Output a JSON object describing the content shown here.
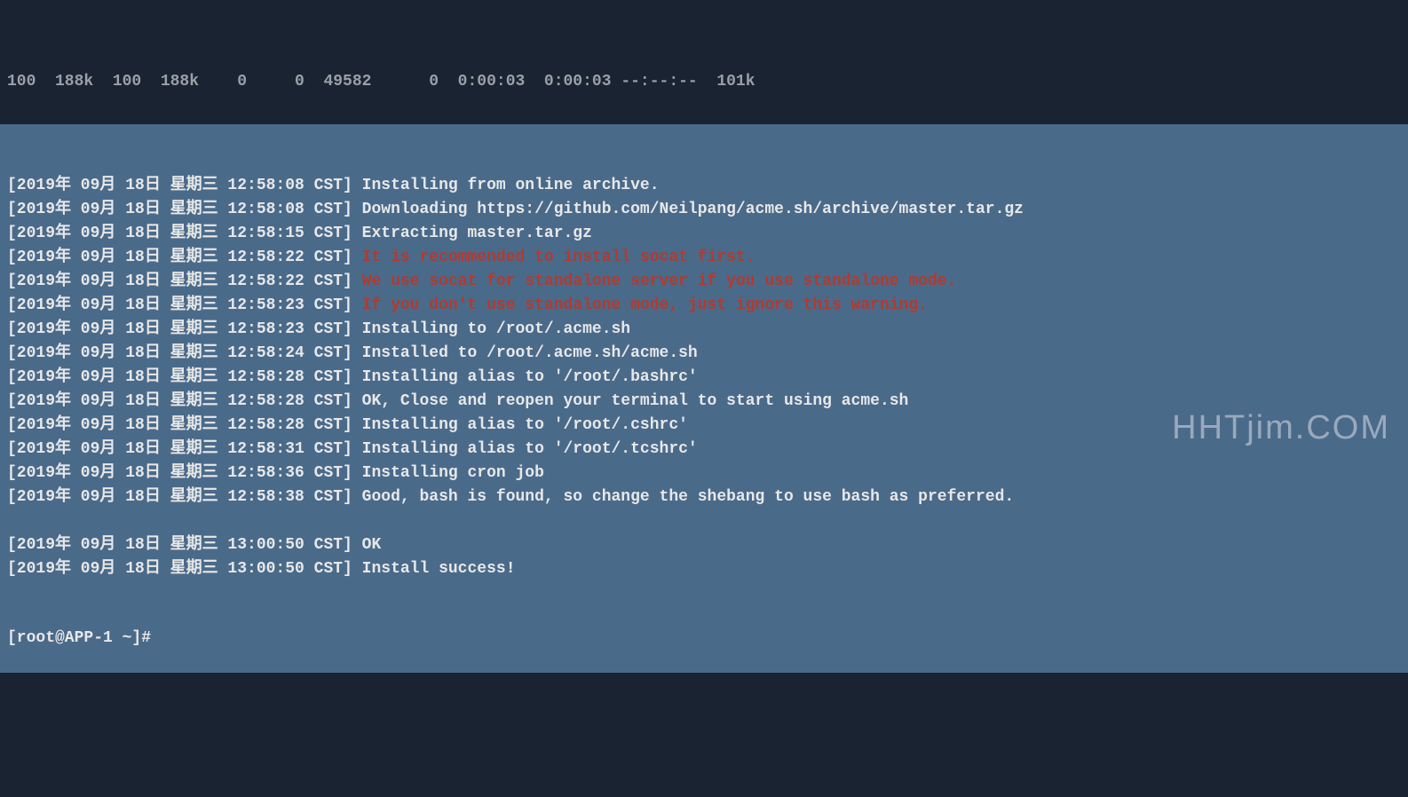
{
  "header": "100  188k  100  188k    0     0  49582      0  0:00:03  0:00:03 --:--:--  101k",
  "lines": [
    {
      "ts": "[2019年 09月 18日 星期三 12:58:08 CST]",
      "msg": " Installing from online archive.",
      "type": "normal"
    },
    {
      "ts": "[2019年 09月 18日 星期三 12:58:08 CST]",
      "msg": " Downloading https://github.com/Neilpang/acme.sh/archive/master.tar.gz",
      "type": "normal"
    },
    {
      "ts": "[2019年 09月 18日 星期三 12:58:15 CST]",
      "msg": " Extracting master.tar.gz",
      "type": "normal"
    },
    {
      "ts": "[2019年 09月 18日 星期三 12:58:22 CST]",
      "msg": " It is recommended to install socat first.",
      "type": "warning"
    },
    {
      "ts": "[2019年 09月 18日 星期三 12:58:22 CST]",
      "msg": " We use socat for standalone server if you use standalone mode.",
      "type": "warning"
    },
    {
      "ts": "[2019年 09月 18日 星期三 12:58:23 CST]",
      "msg": " If you don't use standalone mode, just ignore this warning.",
      "type": "warning"
    },
    {
      "ts": "[2019年 09月 18日 星期三 12:58:23 CST]",
      "msg": " Installing to /root/.acme.sh",
      "type": "normal"
    },
    {
      "ts": "[2019年 09月 18日 星期三 12:58:24 CST]",
      "msg": " Installed to /root/.acme.sh/acme.sh",
      "type": "normal"
    },
    {
      "ts": "[2019年 09月 18日 星期三 12:58:28 CST]",
      "msg": " Installing alias to '/root/.bashrc'",
      "type": "normal"
    },
    {
      "ts": "[2019年 09月 18日 星期三 12:58:28 CST]",
      "msg": " OK, Close and reopen your terminal to start using acme.sh",
      "type": "normal"
    },
    {
      "ts": "[2019年 09月 18日 星期三 12:58:28 CST]",
      "msg": " Installing alias to '/root/.cshrc'",
      "type": "normal"
    },
    {
      "ts": "[2019年 09月 18日 星期三 12:58:31 CST]",
      "msg": " Installing alias to '/root/.tcshrc'",
      "type": "normal"
    },
    {
      "ts": "[2019年 09月 18日 星期三 12:58:36 CST]",
      "msg": " Installing cron job",
      "type": "normal"
    },
    {
      "ts": "[2019年 09月 18日 星期三 12:58:38 CST]",
      "msg": " Good, bash is found, so change the shebang to use bash as preferred.",
      "type": "normal"
    },
    {
      "blank": true
    },
    {
      "ts": "[2019年 09月 18日 星期三 13:00:50 CST]",
      "msg": " OK",
      "type": "normal"
    },
    {
      "ts": "[2019年 09月 18日 星期三 13:00:50 CST]",
      "msg": " Install success!",
      "type": "normal"
    }
  ],
  "prompt": "[root@APP-1 ~]#",
  "watermark": "HHTjim.COM"
}
